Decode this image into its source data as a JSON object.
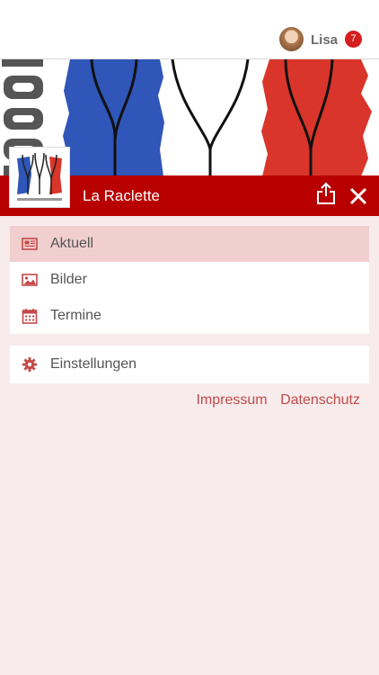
{
  "user": {
    "name": "Lisa",
    "notifications": "7"
  },
  "header": {
    "title": "La Raclette"
  },
  "menu": {
    "main": [
      {
        "label": "Aktuell",
        "icon": "newspaper-icon",
        "active": true
      },
      {
        "label": "Bilder",
        "icon": "image-icon",
        "active": false
      },
      {
        "label": "Termine",
        "icon": "calendar-icon",
        "active": false
      }
    ],
    "settings": {
      "label": "Einstellungen",
      "icon": "gear-icon"
    }
  },
  "footer_links": {
    "impressum": "Impressum",
    "datenschutz": "Datenschutz"
  },
  "colors": {
    "accent": "#b80000",
    "active_bg": "#f1cfcf",
    "background": "#f8ebeb",
    "icon": "#c54848"
  }
}
